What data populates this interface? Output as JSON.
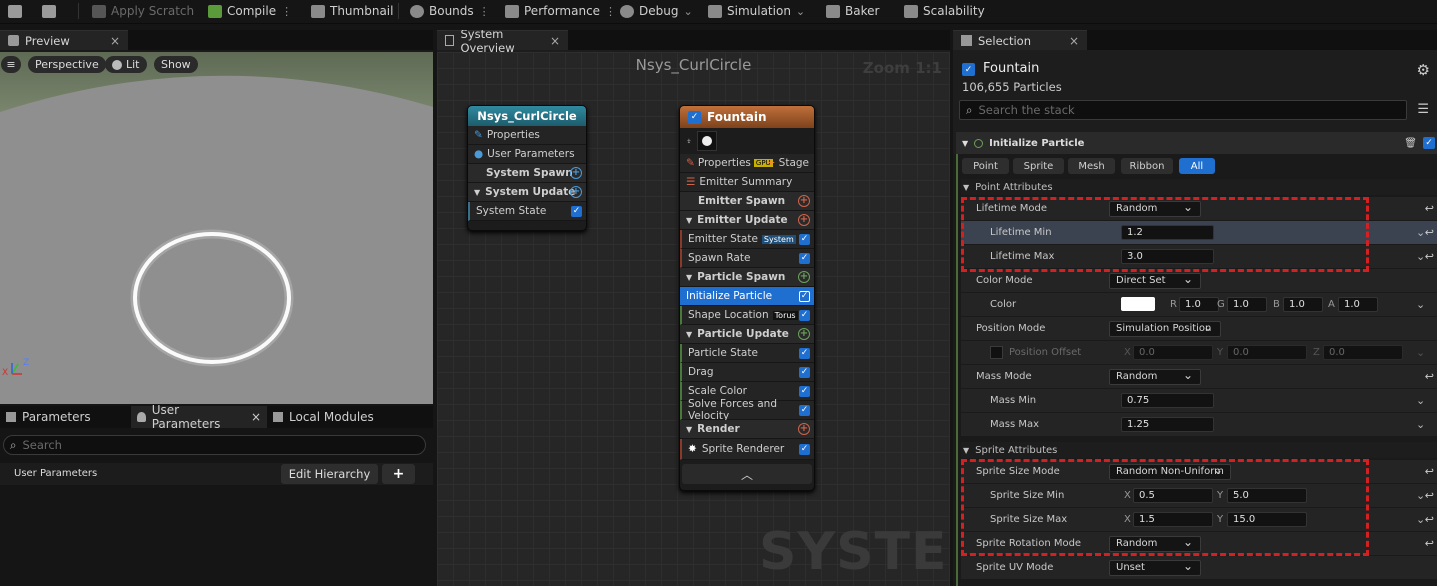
{
  "toolbar": {
    "apply_scratch": "Apply Scratch",
    "compile": "Compile",
    "thumbnail": "Thumbnail",
    "bounds": "Bounds",
    "performance": "Performance",
    "debug": "Debug",
    "simulation": "Simulation",
    "baker": "Baker",
    "scalability": "Scalability"
  },
  "preview": {
    "tab": "Preview",
    "perspective": "Perspective",
    "lit": "Lit",
    "show": "Show",
    "axis_x": "X",
    "axis_z": "Z"
  },
  "params": {
    "tab_parameters": "Parameters",
    "tab_user_parameters": "User Parameters",
    "tab_local_modules": "Local Modules",
    "search_placeholder": "Search",
    "user_parameters_label": "User Parameters",
    "edit_hierarchy": "Edit Hierarchy",
    "add": "+"
  },
  "graph": {
    "tab": "System Overview",
    "title": "Nsys_CurlCircle",
    "zoom": "Zoom 1:1",
    "watermark": "SYSTEM",
    "system_node": {
      "title": "Nsys_CurlCircle",
      "properties": "Properties",
      "user_parameters": "User Parameters",
      "system_spawn": "System Spawn",
      "system_update": "System Update",
      "system_state": "System State"
    },
    "emitter_node": {
      "title": "Fountain",
      "properties": "Properties",
      "gpu": "GPU",
      "stage": "Stage",
      "emitter_summary": "Emitter Summary",
      "emitter_spawn": "Emitter Spawn",
      "emitter_update": "Emitter Update",
      "emitter_state": "Emitter State",
      "emitter_state_badge": "System",
      "spawn_rate": "Spawn Rate",
      "particle_spawn": "Particle Spawn",
      "initialize_particle": "Initialize Particle",
      "shape_location": "Shape Location",
      "shape_location_badge": "Torus",
      "particle_update": "Particle Update",
      "particle_state": "Particle State",
      "drag": "Drag",
      "scale_color": "Scale Color",
      "solve_forces": "Solve Forces and Velocity",
      "render": "Render",
      "sprite_renderer": "Sprite Renderer"
    }
  },
  "selection": {
    "tab": "Selection",
    "emitter_name": "Fountain",
    "particle_count": "106,655 Particles",
    "search_placeholder": "Search the stack",
    "module": "Initialize Particle",
    "filters": [
      "Point",
      "Sprite",
      "Mesh",
      "Ribbon",
      "All"
    ],
    "point_attributes": "Point Attributes",
    "lifetime_mode_label": "Lifetime Mode",
    "lifetime_mode_value": "Random",
    "lifetime_min_label": "Lifetime Min",
    "lifetime_min_value": "1.2",
    "lifetime_max_label": "Lifetime Max",
    "lifetime_max_value": "3.0",
    "color_mode_label": "Color Mode",
    "color_mode_value": "Direct Set",
    "color_label": "Color",
    "color_r": "1.0",
    "color_g": "1.0",
    "color_b": "1.0",
    "color_a": "1.0",
    "ch_r": "R",
    "ch_g": "G",
    "ch_b": "B",
    "ch_a": "A",
    "position_mode_label": "Position Mode",
    "position_mode_value": "Simulation Position",
    "position_offset_label": "Position Offset",
    "pos_x": "0.0",
    "pos_y": "0.0",
    "pos_z": "0.0",
    "ax_x": "X",
    "ax_y": "Y",
    "ax_z": "Z",
    "mass_mode_label": "Mass Mode",
    "mass_mode_value": "Random",
    "mass_min_label": "Mass Min",
    "mass_min_value": "0.75",
    "mass_max_label": "Mass Max",
    "mass_max_value": "1.25",
    "sprite_attributes": "Sprite Attributes",
    "sprite_size_mode_label": "Sprite Size Mode",
    "sprite_size_mode_value": "Random Non-Uniform",
    "sprite_size_min_label": "Sprite Size Min",
    "sprite_size_min_x": "0.5",
    "sprite_size_min_y": "5.0",
    "sprite_size_max_label": "Sprite Size Max",
    "sprite_size_max_x": "1.5",
    "sprite_size_max_y": "15.0",
    "sprite_rotation_mode_label": "Sprite Rotation Mode",
    "sprite_rotation_mode_value": "Random",
    "sprite_uv_mode_label": "Sprite UV Mode",
    "sprite_uv_mode_value": "Unset"
  }
}
